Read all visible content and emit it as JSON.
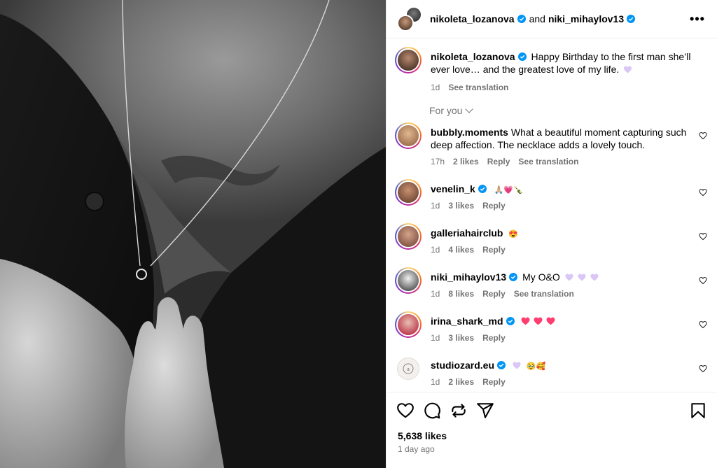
{
  "header": {
    "user1": "nikoleta_lozanova",
    "and_text": "and",
    "user2": "niki_mihaylov13",
    "more_label": "•••"
  },
  "caption": {
    "username": "nikoleta_lozanova",
    "text": "Happy Birthday to the first man she’ll ever love… and the greatest love of my life.",
    "time": "1d",
    "translate": "See translation"
  },
  "for_you_label": "For you",
  "comments": [
    {
      "username": "bubbly.moments",
      "text": "What a beautiful moment capturing such deep affection. The necklace adds a lovely touch.",
      "time": "17h",
      "likes": "2 likes",
      "reply": "Reply",
      "translate": "See translation"
    },
    {
      "username": "venelin_k",
      "emoji": "🙏🏼💗🍾",
      "time": "1d",
      "likes": "3 likes",
      "reply": "Reply"
    },
    {
      "username": "galleriahairclub",
      "emoji": "😍",
      "time": "1d",
      "likes": "4 likes",
      "reply": "Reply"
    },
    {
      "username": "niki_mihaylov13",
      "text": "My O&O",
      "time": "1d",
      "likes": "8 likes",
      "reply": "Reply",
      "translate": "See translation"
    },
    {
      "username": "irina_shark_md",
      "time": "1d",
      "likes": "3 likes",
      "reply": "Reply"
    },
    {
      "username": "studiozard.eu",
      "emoji": "🥹🥰",
      "time": "1d",
      "likes": "2 likes",
      "reply": "Reply"
    }
  ],
  "footer": {
    "likes": "5,638 likes",
    "ago": "1 day ago"
  },
  "colors": {
    "verified": "#0095f6",
    "muted": "#737373",
    "heart_pink": "#ff3d71",
    "heart_lilac": "#d9c8f5"
  },
  "icons": [
    "heart-icon",
    "comment-icon",
    "repost-icon",
    "share-icon",
    "bookmark-icon",
    "more-icon",
    "verified-icon",
    "chevron-down-icon"
  ]
}
